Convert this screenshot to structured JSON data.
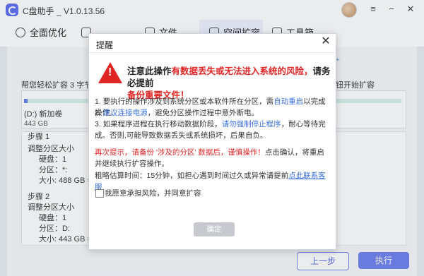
{
  "app": {
    "title": "C盘助手 _ V1.0.13.56",
    "window_controls": {
      "menu": "≡",
      "minimize": "−",
      "close": "✕"
    }
  },
  "tabs": [
    {
      "label": "全面优化",
      "active": false
    },
    {
      "label": "…",
      "active": false
    },
    {
      "label": "文件…",
      "active": false
    },
    {
      "label": "空间扩容",
      "active": true
    },
    {
      "label": "工具箱",
      "active": false
    }
  ],
  "background": {
    "link_right": "扩",
    "hint_left": "帮您轻松扩容 3 字节 只",
    "hint_right": "钮开始扩容",
    "partition": {
      "name": "(D:) 新加卷",
      "size": "443 GB",
      "bar_fill_fraction": 0.01
    },
    "steps": [
      "步骤 1",
      "调整分区大小",
      "硬盘：1",
      "分区：*:",
      "大小: 488 GB ==",
      "步骤 2",
      "调整分区大小",
      "硬盘：1",
      "分区：D:",
      "大小: 443 GB =="
    ],
    "buttons": {
      "prev": "上一步",
      "execute": "执行"
    }
  },
  "dialog": {
    "title": "提醒",
    "close_label": "✕",
    "warning_icon": "warning-triangle-icon",
    "headline": {
      "a": "注意此操作",
      "b": "有数据丢失或无法进入系统的风险，",
      "c": "请务必提前",
      "d": "备份重要文件！"
    },
    "items": {
      "p1_a": "1. 要执行的操作涉及到系统分区或本软件所在分区，需",
      "p1_b": "自动重启",
      "p1_c": "以完成操作。",
      "p2_a": "2. ",
      "p2_b": "建议连接电源",
      "p2_c": "，避免分区操作过程中意外断电。",
      "p3_a": "3. 如果程序进程在执行移动数据阶段，",
      "p3_b": "请勿强制停止程序",
      "p3_c": "，耐心等待完成。否则,可能导致数据丢失或系统损坏，后果自负。"
    },
    "reminder": {
      "red": "再次提示，请备份 '涉及的分区' 数据后，谨慎操作！",
      "rest": "点击确认，将重启并继续执行扩容操作。"
    },
    "estimate": {
      "a": "粗略估算时间：15分钟，如担心遇到时间过久或异常请提前",
      "link": "点此联系客服"
    },
    "checkbox_label": "我愿意承担风险，并同意扩容",
    "checkbox_checked": false,
    "confirm_label": "确定",
    "colors": {
      "danger": "#e02424",
      "link": "#3a6fe0",
      "disabled": "#c8c9cf"
    }
  }
}
